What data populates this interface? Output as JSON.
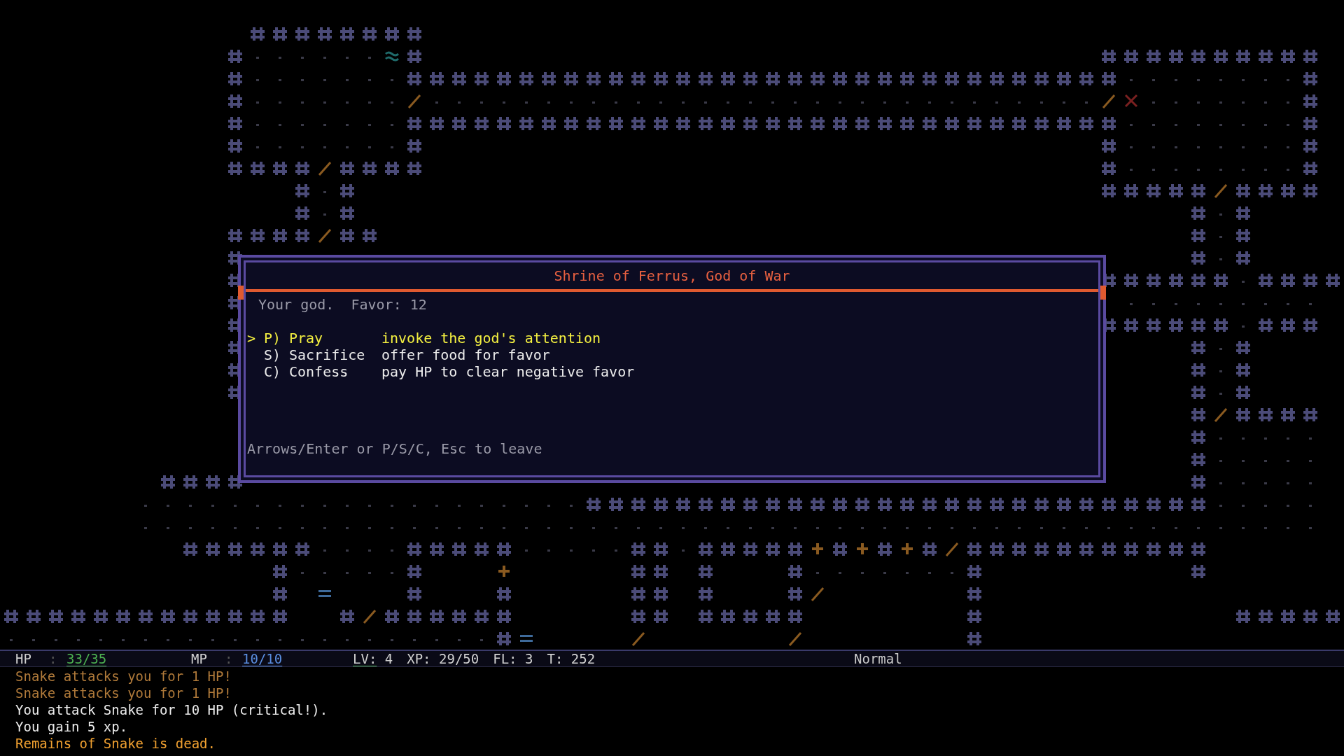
{
  "dialog": {
    "title": "Shrine of Ferrus, God of War",
    "info": "Your god.  Favor: 12",
    "cursor": ">",
    "options": [
      {
        "key": "P)",
        "label": "Pray",
        "description": "invoke the god's attention",
        "selected": true
      },
      {
        "key": "S)",
        "label": "Sacrifice",
        "description": "offer food for favor",
        "selected": false
      },
      {
        "key": "C)",
        "label": "Confess",
        "description": "pay HP to clear negative favor",
        "selected": false
      }
    ],
    "hint": "Arrows/Enter or P/S/C, Esc to leave"
  },
  "status_bar": {
    "gauges": [
      {
        "label": "HP",
        "separator": ":",
        "value": "33/35",
        "color": "#4caf50"
      },
      {
        "label": "MP",
        "separator": ":",
        "value": "10/10",
        "color": "#5a8ee0"
      }
    ],
    "stats": [
      {
        "label": "LV:",
        "value": "4",
        "underlined": true
      },
      {
        "label": "XP:",
        "value": "29/50",
        "underlined": false
      },
      {
        "label": "FL:",
        "value": "3",
        "underlined": false
      },
      {
        "label": "T:",
        "value": "252",
        "underlined": false
      }
    ],
    "difficulty": "Normal"
  },
  "log": [
    {
      "kind": "damage",
      "text": "Snake attacks you for 1 HP!"
    },
    {
      "kind": "damage",
      "text": "Snake attacks you for 1 HP!"
    },
    {
      "kind": "info",
      "text": "You attack Snake for 10 HP (critical!)."
    },
    {
      "kind": "info",
      "text": "You gain 5 xp."
    },
    {
      "kind": "death",
      "text": "Remains of Snake is dead."
    }
  ]
}
